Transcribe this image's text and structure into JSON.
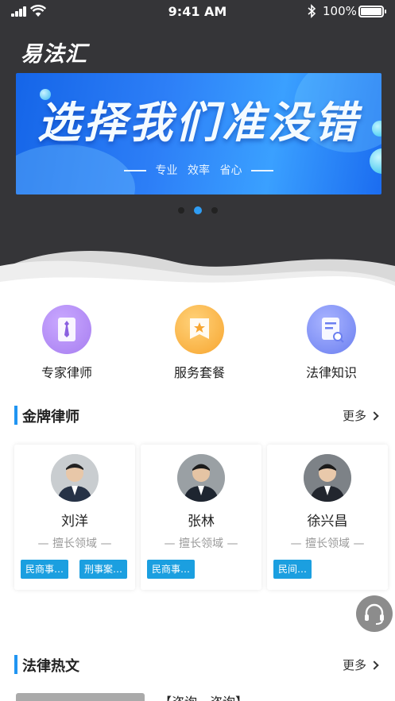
{
  "status_bar": {
    "time": "9:41 AM",
    "battery_pct": "100%"
  },
  "app": {
    "logo_text": "易法汇"
  },
  "banner": {
    "headline": "选择我们准没错",
    "tagline_words": [
      "专业",
      "效率",
      "省心"
    ],
    "page_count": 3,
    "active_page": 2
  },
  "quick_menu": [
    {
      "label": "专家律师",
      "icon": "tie-icon",
      "color": "#a77ef0"
    },
    {
      "label": "服务套餐",
      "icon": "star-ticket-icon",
      "color": "#f7a52f"
    },
    {
      "label": "法律知识",
      "icon": "document-search-icon",
      "color": "#6b7ff0"
    }
  ],
  "gold_lawyers": {
    "title": "金牌律师",
    "more_label": "更多",
    "field_label": "— 擅长领域 —",
    "lawyers": [
      {
        "name": "刘洋",
        "tags": [
          "民商事…",
          "刑事案…"
        ]
      },
      {
        "name": "张林",
        "tags": [
          "民商事…"
        ]
      },
      {
        "name": "徐兴昌",
        "tags": [
          "民间…"
        ]
      }
    ]
  },
  "hot_articles": {
    "title": "法律热文",
    "more_label": "更多",
    "first_title": "【咨询、咨询】"
  },
  "colors": {
    "accent": "#2195f2",
    "tag": "#1b9fe0",
    "header_bg": "#353538"
  }
}
